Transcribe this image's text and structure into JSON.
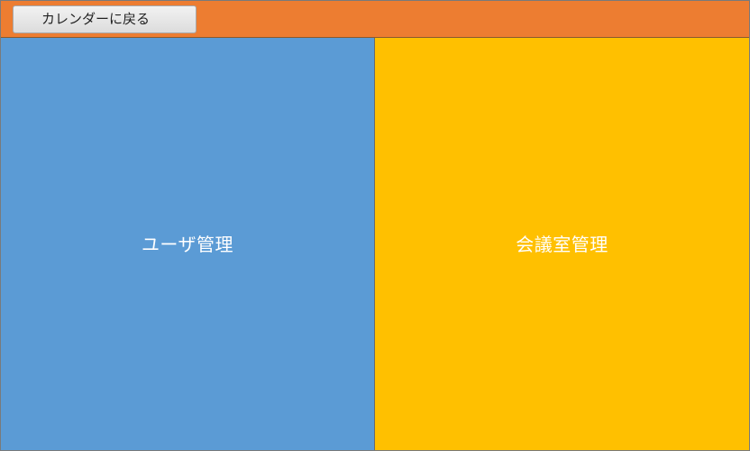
{
  "header": {
    "back_button_label": "カレンダーに戻る"
  },
  "menu": {
    "users_label": "ユーザ管理",
    "rooms_label": "会議室管理"
  },
  "colors": {
    "header_bg": "#ED7D31",
    "users_panel_bg": "#5B9BD5",
    "rooms_panel_bg": "#FFC000"
  }
}
